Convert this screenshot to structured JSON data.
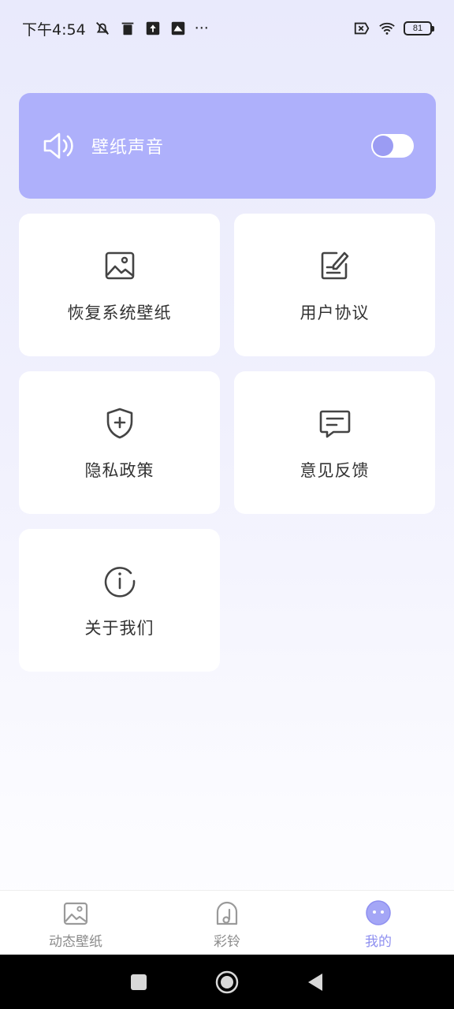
{
  "status_bar": {
    "time": "下午4:54",
    "more": "···",
    "battery_level": "81",
    "icons": [
      "mute-icon",
      "trash-icon",
      "upload-icon",
      "screen-icon",
      "no-sim-icon",
      "wifi-icon",
      "battery-icon"
    ]
  },
  "sound_setting": {
    "label": "壁纸声音",
    "icon": "speaker-icon",
    "enabled": false
  },
  "tiles": [
    {
      "label": "恢复系统壁纸",
      "icon": "image-icon"
    },
    {
      "label": "用户协议",
      "icon": "edit-document-icon"
    },
    {
      "label": "隐私政策",
      "icon": "shield-plus-icon"
    },
    {
      "label": "意见反馈",
      "icon": "message-icon"
    },
    {
      "label": "关于我们",
      "icon": "info-icon"
    }
  ],
  "bottom_nav": {
    "items": [
      {
        "label": "动态壁纸",
        "icon": "image-icon",
        "active": false
      },
      {
        "label": "彩铃",
        "icon": "bell-icon",
        "active": false
      },
      {
        "label": "我的",
        "icon": "face-icon",
        "active": true
      }
    ]
  },
  "colors": {
    "accent": "#8e8ff0",
    "sound_card_bg": "#aeb0fb",
    "tile_bg": "#ffffff",
    "inactive_text": "#8c8c8c"
  },
  "system_nav": [
    "square-icon",
    "home-circle-icon",
    "back-triangle-icon"
  ]
}
